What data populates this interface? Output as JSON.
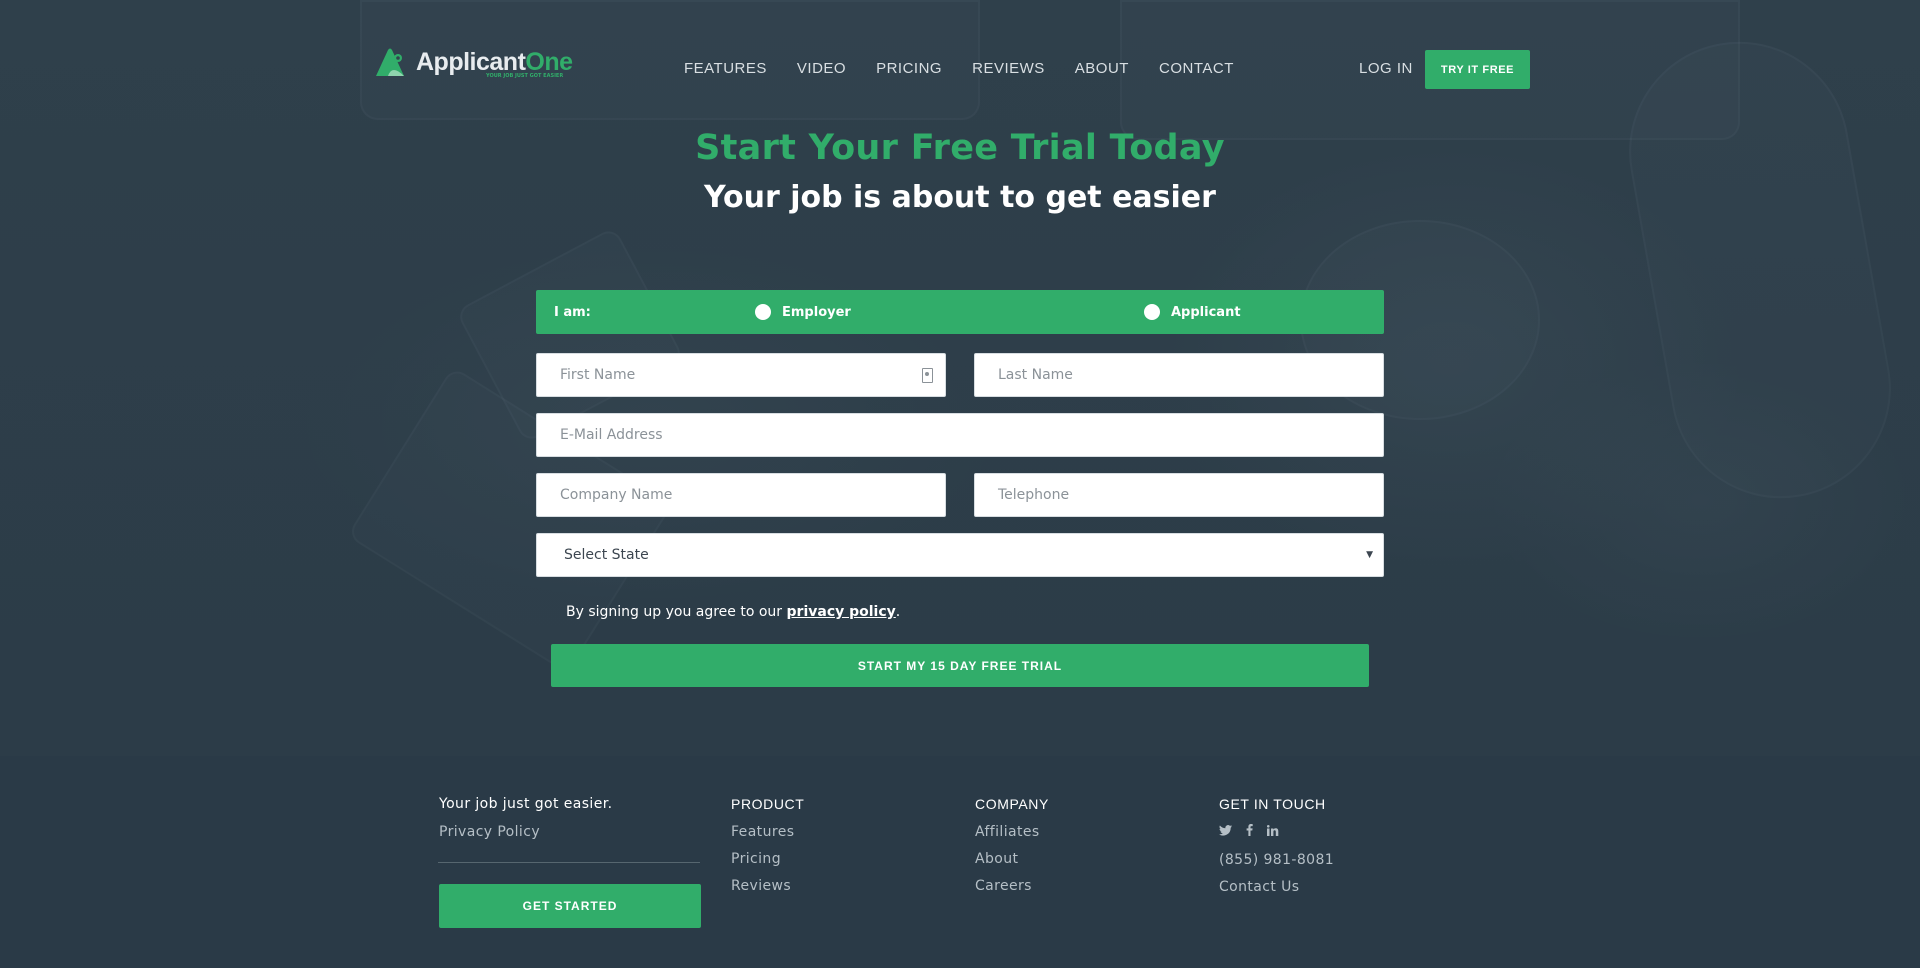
{
  "brand": {
    "name_part1": "Applicant",
    "name_part2": "One",
    "tagline": "YOUR JOB JUST GOT EASIER",
    "accent_color": "#31ad6a"
  },
  "nav": {
    "items": [
      "FEATURES",
      "VIDEO",
      "PRICING",
      "REVIEWS",
      "ABOUT",
      "CONTACT"
    ],
    "login_label": "LOG IN",
    "try_label": "TRY IT FREE"
  },
  "hero": {
    "title": "Start Your Free Trial Today",
    "subtitle": "Your job is about to get easier"
  },
  "form": {
    "role_label": "I am:",
    "role_options": [
      "Employer",
      "Applicant"
    ],
    "first_name_placeholder": "First Name",
    "last_name_placeholder": "Last Name",
    "email_placeholder": "E-Mail Address",
    "company_placeholder": "Company Name",
    "telephone_placeholder": "Telephone",
    "state_selected": "Select State",
    "agree_text": "By signing up you agree to our ",
    "privacy_link": "privacy policy",
    "agree_suffix": ".",
    "submit_label": "START MY 15 DAY FREE TRIAL"
  },
  "footer": {
    "tagline": "Your job just got easier.",
    "privacy_link": "Privacy Policy",
    "get_started_label": "GET STARTED",
    "product": {
      "heading": "PRODUCT",
      "links": [
        "Features",
        "Pricing",
        "Reviews"
      ]
    },
    "company": {
      "heading": "COMPANY",
      "links": [
        "Affiliates",
        "About",
        "Careers"
      ]
    },
    "contact": {
      "heading": "GET IN TOUCH",
      "social_icons": [
        "twitter-icon",
        "facebook-icon",
        "linkedin-icon"
      ],
      "phone": "(855) 981-8081",
      "contact_link": "Contact Us"
    }
  }
}
